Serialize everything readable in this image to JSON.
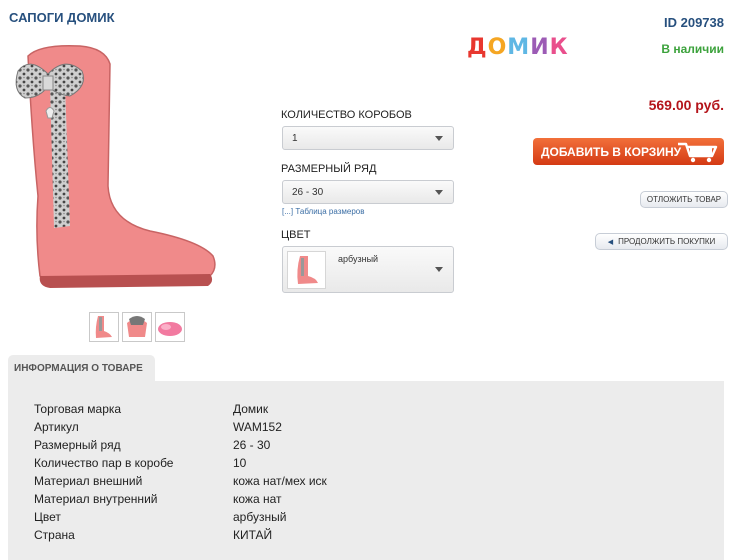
{
  "product": {
    "title": "САПОГИ ДОМИК",
    "id_label": "ID 209738",
    "brand_logo": [
      "Д",
      "О",
      "М",
      "И",
      "К"
    ],
    "stock": "В наличии",
    "price": "569.00 руб.",
    "add_to_cart": "ДОБАВИТЬ В КОРЗИНУ",
    "defer": "ОТЛОЖИТЬ ТОВАР",
    "continue": "ПРОДОЛЖИТЬ ПОКУПКИ"
  },
  "options": {
    "boxes_label": "КОЛИЧЕСТВО КОРОБОВ",
    "boxes_value": "1",
    "size_label": "РАЗМЕРНЫЙ РЯД",
    "size_value": "26 - 30",
    "size_table_link": "[...] Таблица размеров",
    "color_label": "ЦВЕТ",
    "color_value": "арбузный"
  },
  "info": {
    "tab_label": "ИНФОРМАЦИЯ О ТОВАРЕ",
    "rows": [
      {
        "label": "Торговая марка",
        "value": "Домик"
      },
      {
        "label": "Артикул",
        "value": "WAM152"
      },
      {
        "label": "Размерный ряд",
        "value": "26 - 30"
      },
      {
        "label": "Количество пар в коробе",
        "value": "10"
      },
      {
        "label": "Материал внешний",
        "value": "кожа нат/мех иск"
      },
      {
        "label": "Материал внутренний",
        "value": "кожа нат"
      },
      {
        "label": "Цвет",
        "value": "арбузный"
      },
      {
        "label": "Страна",
        "value": "КИТАЙ"
      }
    ]
  },
  "colors": {
    "title": "#27507e",
    "price": "#b4141a",
    "stock": "#3ca23c",
    "cart_button": "#e0522a",
    "boot": "#f08a8a"
  },
  "icons": {
    "cart": "cart-icon",
    "back": "arrow-left-icon"
  }
}
